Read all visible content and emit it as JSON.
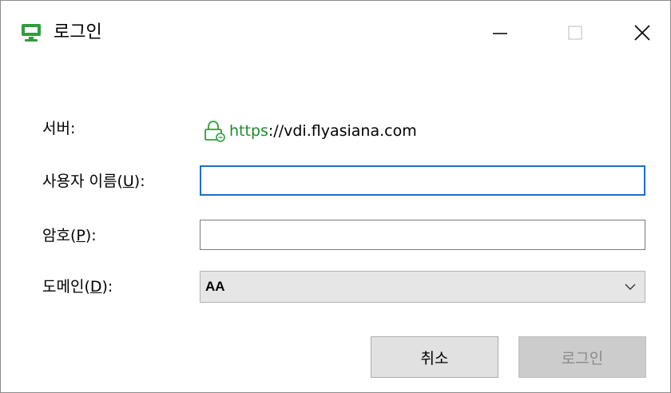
{
  "window": {
    "title": "로그인",
    "controls": {
      "minimize": "minimize-icon",
      "maximize": "maximize-icon",
      "close": "close-icon"
    }
  },
  "form": {
    "server": {
      "label": "서버:",
      "scheme": "https",
      "rest": "://vdi.flyasiana.com"
    },
    "username": {
      "label_prefix": "사용자 이름(",
      "mnemonic": "U",
      "label_suffix": "):",
      "value": ""
    },
    "password": {
      "label_prefix": "암호(",
      "mnemonic": "P",
      "label_suffix": "):",
      "value": ""
    },
    "domain": {
      "label_prefix": "도메인(",
      "mnemonic": "D",
      "label_suffix": "):",
      "value": "AA"
    }
  },
  "buttons": {
    "cancel": "취소",
    "login": "로그인"
  },
  "colors": {
    "accent_green": "#1e8c2f",
    "focus_blue": "#1a6fc9",
    "disabled_text": "#8a8a8a"
  }
}
